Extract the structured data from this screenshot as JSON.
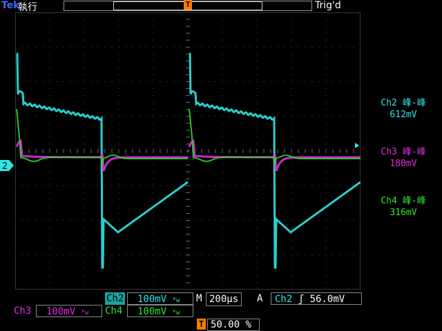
{
  "status": {
    "brand": "Tek",
    "run_state": "執行",
    "trigger_state": "Trig'd",
    "trigger_marker": "T"
  },
  "channel_marker": "2",
  "measurements": [
    {
      "label": "Ch2 峰-峰",
      "value": "612mV",
      "color": "#2ee6e6"
    },
    {
      "label": "Ch3 峰-峰",
      "value": "180mV",
      "color": "#e02ee0"
    },
    {
      "label": "Ch4 峰-峰",
      "value": "316mV",
      "color": "#2ee62e"
    }
  ],
  "bottom": {
    "ch2_tag": "Ch2",
    "ch2_scale": "100mV",
    "ch2_bw": "ᴮw",
    "ch3_tag": "Ch3",
    "ch3_scale": "100mV",
    "ch3_bw": "ᴮw",
    "ch4_tag": "Ch4",
    "ch4_scale": "100mV",
    "ch4_bw": "ᴮw",
    "timebase_label": "M",
    "timebase_value": "200µs",
    "acq_mode": "A",
    "trig_source": "Ch2",
    "trig_slope": "ʃ",
    "trig_level": "56.0mV",
    "trig_pos_icon": "T",
    "trig_pos_value": "50.00 %"
  },
  "colors": {
    "ch2": "#2ee6e6",
    "ch3": "#e02ee0",
    "ch4": "#2ee62e",
    "trigger": "#ff7a00",
    "grid": "#5a5a5a"
  }
}
